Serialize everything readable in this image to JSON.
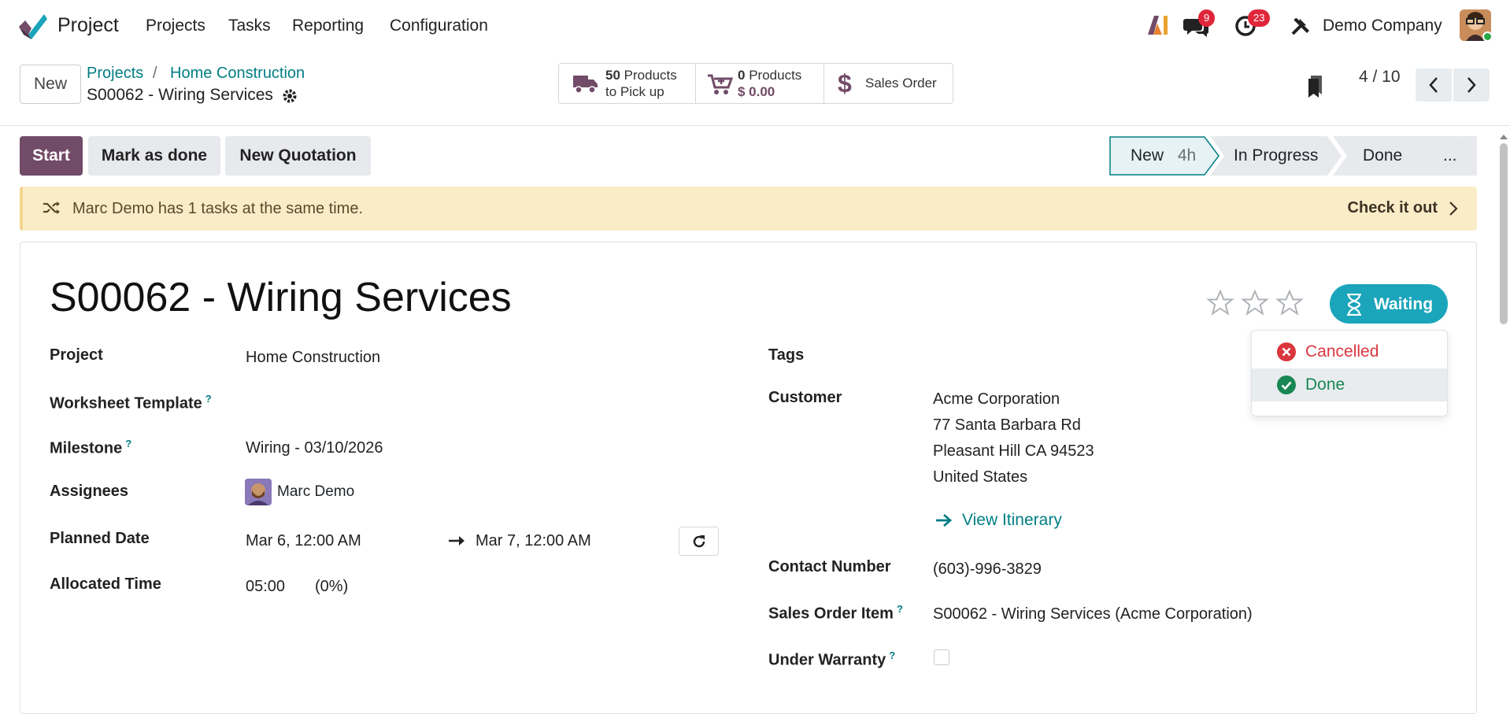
{
  "nav": {
    "app_name": "Project",
    "menu": [
      "Projects",
      "Tasks",
      "Reporting",
      "Configuration"
    ],
    "messages_count": "9",
    "activities_count": "23",
    "company": "Demo Company",
    "ai_label": "AI"
  },
  "control": {
    "new_label": "New",
    "breadcrumb": [
      "Projects",
      "Home Construction"
    ],
    "breadcrumb_sep": "/",
    "record_name": "S00062 - Wiring Services",
    "smart_buttons": {
      "pick_count": "50",
      "pick_line1": "Products",
      "pick_line2": "to Pick up",
      "products_count": "0",
      "products_line1": "Products",
      "products_amount": "$ 0.00",
      "sales_order": "Sales Order"
    },
    "pager": "4 / 10"
  },
  "actions": {
    "start": "Start",
    "mark_done": "Mark as done",
    "new_quotation": "New Quotation"
  },
  "stages": {
    "items": [
      "New",
      "In Progress",
      "Done",
      "..."
    ],
    "new_duration": "4h",
    "active": "New"
  },
  "alert": {
    "text": "Marc Demo has 1 tasks at the same time.",
    "link": "Check it out"
  },
  "form": {
    "title": "S00062 - Wiring Services",
    "priority_stars": 0,
    "state_label": "Waiting",
    "state_menu": [
      "Cancelled",
      "Done"
    ],
    "help_mark": "?",
    "left": {
      "project_label": "Project",
      "project": "Home Construction",
      "worksheet_label": "Worksheet Template",
      "milestone_label": "Milestone",
      "milestone": "Wiring - 03/10/2026",
      "assignees_label": "Assignees",
      "assignee": "Marc Demo",
      "planned_label": "Planned Date",
      "planned_start": "Mar 6, 12:00 AM",
      "planned_end": "Mar 7, 12:00 AM",
      "allocated_label": "Allocated Time",
      "allocated": "05:00",
      "allocated_pct": "(0%)"
    },
    "right": {
      "tags_label": "Tags",
      "customer_label": "Customer",
      "customer_name": "Acme Corporation",
      "customer_street": "77 Santa Barbara Rd",
      "customer_city": "Pleasant Hill CA 94523",
      "customer_country": "United States",
      "itinerary": "View Itinerary",
      "contact_label": "Contact Number",
      "contact": "(603)-996-3829",
      "so_item_label": "Sales Order Item",
      "so_item": "S00062 - Wiring Services (Acme Corporation)",
      "warranty_label": "Under Warranty",
      "warranty_checked": false
    }
  },
  "colors": {
    "primary": "#714b67",
    "link": "#017e84",
    "state": "#1aa5bb",
    "danger": "#d9363e",
    "success": "#198754",
    "alert_bg": "#fbecc8"
  }
}
